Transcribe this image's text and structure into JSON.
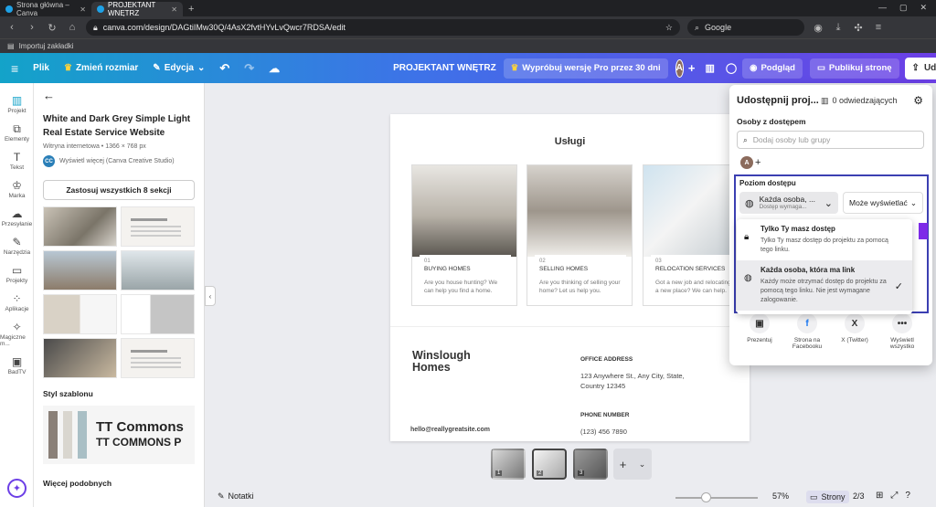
{
  "browser": {
    "tabs": [
      {
        "title": "Strona główna – Canva",
        "active": false
      },
      {
        "title": "PROJEKTANT WNĘTRZ",
        "active": true
      }
    ],
    "url": "canva.com/design/DAGtiIMw30Q/4AsX2fvtHYvLvQwcr7RDSA/edit",
    "search_placeholder": "Google",
    "bookmark": "Importuj zakładki"
  },
  "toolbar": {
    "file": "Plik",
    "resize": "Zmień rozmiar",
    "edit": "Edycja",
    "project_name": "PROJEKTANT WNĘTRZ",
    "pro_trial": "Wypróbuj wersję Pro przez 30 dni",
    "avatar_letter": "A",
    "preview": "Podgląd",
    "publish": "Publikuj stronę",
    "share": "Udostępnij"
  },
  "rail": [
    {
      "label": "Projekt",
      "icon": "▥"
    },
    {
      "label": "Elementy",
      "icon": "⧉"
    },
    {
      "label": "Tekst",
      "icon": "T"
    },
    {
      "label": "Marka",
      "icon": "♔"
    },
    {
      "label": "Przesyłanie",
      "icon": "☁"
    },
    {
      "label": "Narzędzia",
      "icon": "✎"
    },
    {
      "label": "Projekty",
      "icon": "▭"
    },
    {
      "label": "Aplikacje",
      "icon": "⁘"
    },
    {
      "label": "Magiczne m...",
      "icon": "✧"
    },
    {
      "label": "BadTV",
      "icon": "▣"
    }
  ],
  "panel": {
    "template_title": "White and Dark Grey Simple Light Real Estate Service Website",
    "template_meta": "Witryna internetowa • 1366 × 768 px",
    "creator_initials": "CC",
    "creator_text": "Wyświetl więcej (Canva Creative Studio)",
    "apply_button": "Zastosuj wszystkich 8 sekcji",
    "style_header": "Styl szablonu",
    "font_preview_1": "TT Commons",
    "font_preview_2": "TT COMMONS P",
    "more_header": "Więcej podobnych",
    "swatches": [
      "#8a8078",
      "#d9d6cf",
      "#a9bfc5"
    ]
  },
  "page": {
    "services_title": "Usługi",
    "cards": [
      {
        "num": "01",
        "title": "BUYING HOMES",
        "desc": "Are you house hunting? We can help you find a home."
      },
      {
        "num": "02",
        "title": "SELLING HOMES",
        "desc": "Are you thinking of selling your home? Let us help you."
      },
      {
        "num": "03",
        "title": "RELOCATION SERVICES",
        "desc": "Got a new job and relocating to a new place? We can help."
      }
    ],
    "brand": "Winslough Homes",
    "office_label": "OFFICE ADDRESS",
    "office_value": "123 Anywhere St., Any City, State, Country 12345",
    "phone_label": "PHONE NUMBER",
    "phone_value": "(123) 456 7890",
    "email": "hello@reallygreatsite.com"
  },
  "share_popup": {
    "title": "Udostępnij proj...",
    "visitors": "0 odwiedzających",
    "people_header": "Osoby z dostępem",
    "add_placeholder": "Dodaj osoby lub grupy",
    "avatar_letter": "A",
    "access_header": "Poziom dostępu",
    "access_selected_1": "Każda osoba, ...",
    "access_selected_2": "Dostęp wymaga...",
    "permission": "Może wyświetlać",
    "options": [
      {
        "title": "Tylko Ty masz dostęp",
        "desc": "Tylko Ty masz dostęp do projektu za pomocą tego linku."
      },
      {
        "title": "Każda osoba, która ma link",
        "desc": "Każdy może otrzymać dostęp do projektu za pomocą tego linku. Nie jest wymagane zalogowanie."
      }
    ],
    "share_targets": [
      {
        "label": "Prezentuj",
        "icon": "▣"
      },
      {
        "label": "Strona na Facebooku",
        "icon": "f"
      },
      {
        "label": "X (Twitter)",
        "icon": "X"
      },
      {
        "label": "Wyświetl wszystko",
        "icon": "•••"
      }
    ]
  },
  "bottom": {
    "notes": "Notatki",
    "zoom": "57%",
    "pages_btn": "Strony",
    "page_count": "2/3",
    "page_thumbs": [
      "1",
      "2",
      "3"
    ]
  }
}
